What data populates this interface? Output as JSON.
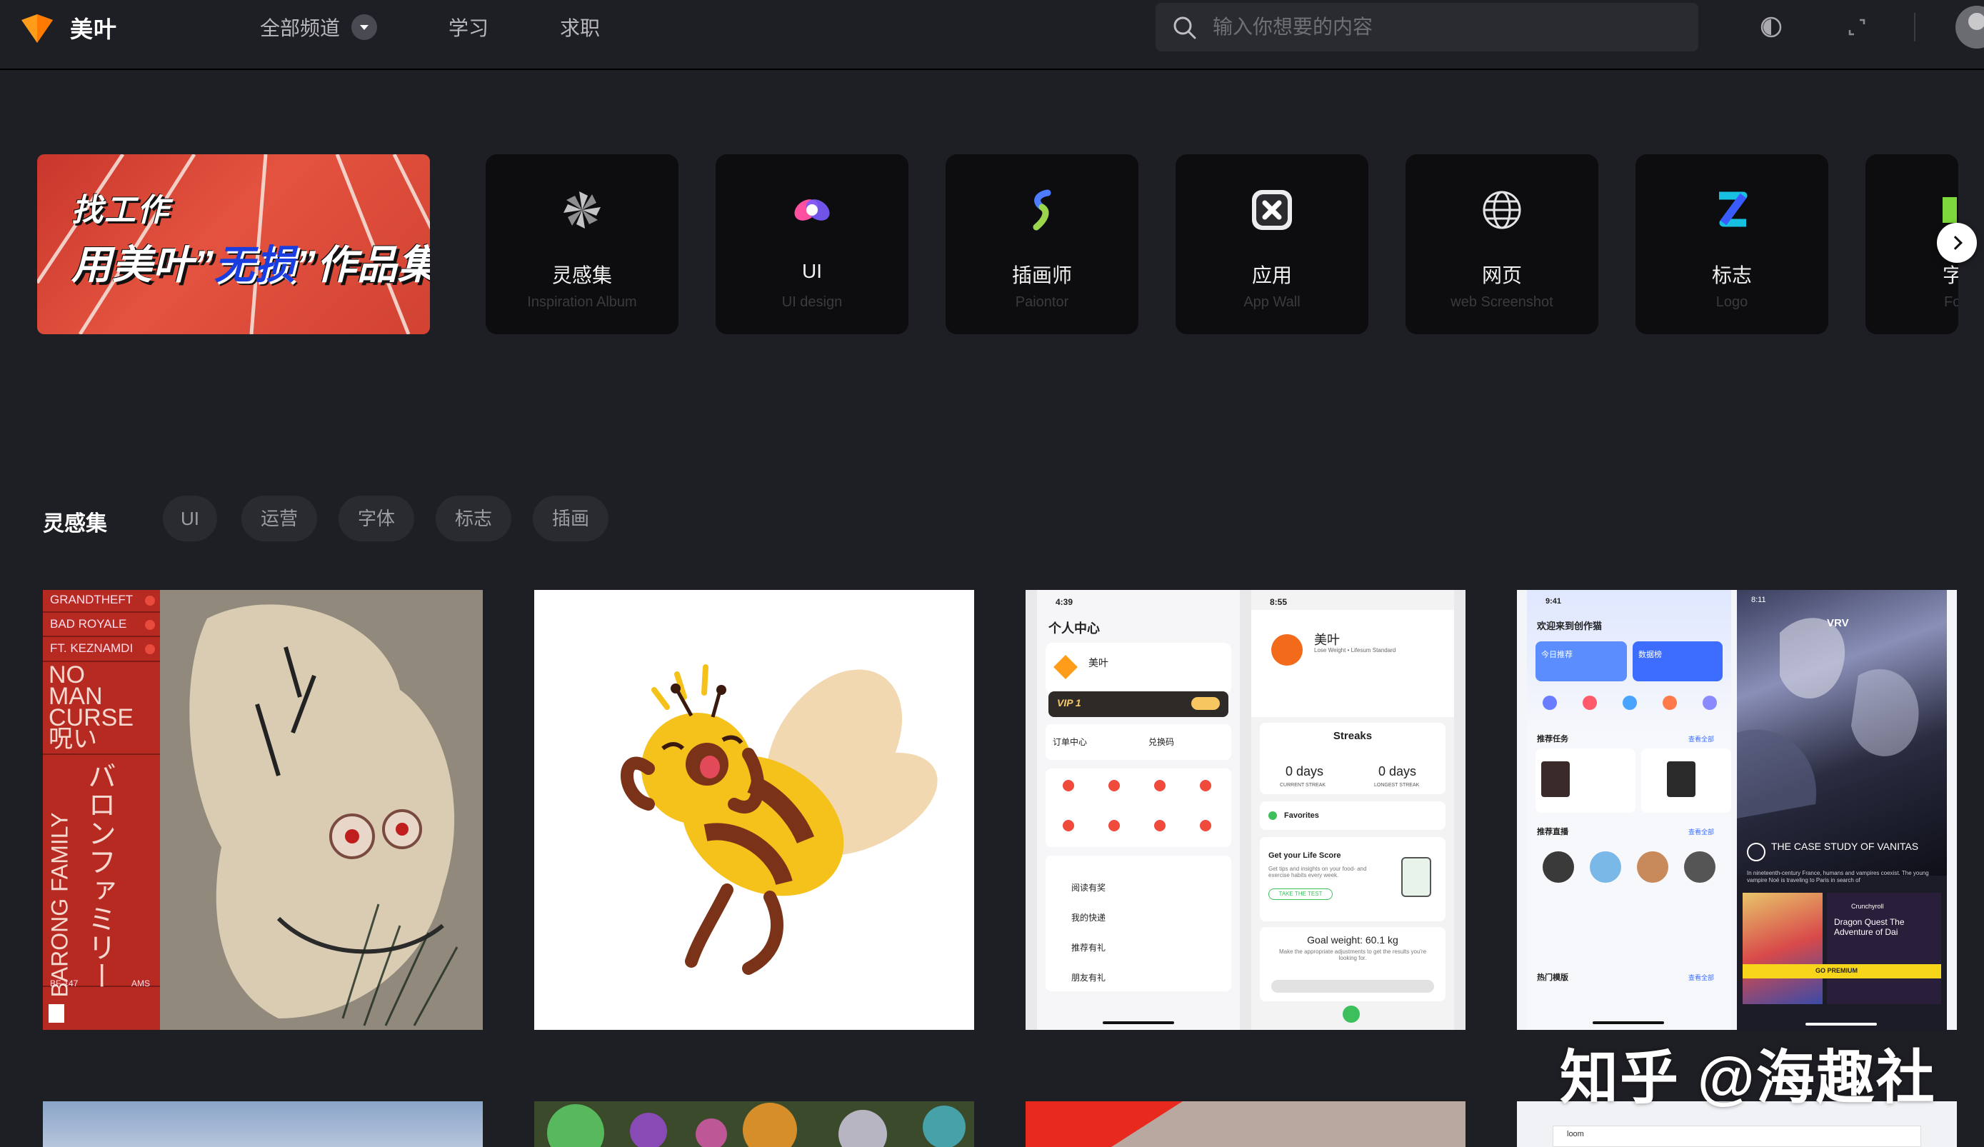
{
  "header": {
    "logo_text": "美叶",
    "nav": [
      "全部频道",
      "学习",
      "求职"
    ],
    "search_placeholder": "输入你想要的内容"
  },
  "banner": {
    "line1": "找工作",
    "line2_a": "用美叶”",
    "line2_b": "无损",
    "line2_c": "”作品集"
  },
  "categories": [
    {
      "title": "灵感集",
      "subtitle": "Inspiration Album",
      "icon": "pinwheel-icon"
    },
    {
      "title": "UI",
      "subtitle": "UI design",
      "icon": "ui-logo-icon"
    },
    {
      "title": "插画师",
      "subtitle": "Paiontor",
      "icon": "brush-icon"
    },
    {
      "title": "应用",
      "subtitle": "App Wall",
      "icon": "app-icon"
    },
    {
      "title": "网页",
      "subtitle": "web Screenshot",
      "icon": "globe-icon"
    },
    {
      "title": "标志",
      "subtitle": "Logo",
      "icon": "logo-z-icon"
    },
    {
      "title": "字",
      "subtitle": "Fo",
      "icon": "font-icon"
    }
  ],
  "section": {
    "title": "灵感集",
    "tags": [
      "UI",
      "运营",
      "字体",
      "标志",
      "插画"
    ]
  },
  "poster": {
    "labels": [
      "GRANDTHEFT",
      "BAD ROYALE",
      "FT. KEZNAMDI"
    ],
    "big": "NO MAN CURSE 呪い",
    "side": "BARONG FAMILY",
    "jp": "バロンファミリー",
    "catalog": "BF-147",
    "ams": "AMS"
  },
  "phone1": {
    "time": "4:39",
    "title": "个人中心",
    "user": "美叶",
    "vip": "VIP 1",
    "row1": [
      "订单中心",
      "兑换码"
    ],
    "list": [
      "阅读有奖",
      "我的快递",
      "推荐有礼",
      "朋友有礼"
    ]
  },
  "phone2": {
    "time": "8:55",
    "app": "美叶",
    "sub": "Lose Weight • Lifesum Standard",
    "streaks": "Streaks",
    "d1": "0 days",
    "d1l": "CURRENT STREAK",
    "d2": "0 days",
    "d2l": "LONGEST STREAK",
    "fav": "Favorites",
    "score": "Get your Life Score",
    "score_desc": "Get tips and insights on your food- and exercise habits every week.",
    "take": "TAKE THE TEST",
    "goal": "Goal weight: 60.1 kg",
    "goal_desc": "Make the appropriate adjustments to get the results you're looking for."
  },
  "phone3": {
    "time": "9:41",
    "title": "欢迎来到创作猫",
    "b1": "今日推荐",
    "b2": "数据榜",
    "sec1": "推荐任务",
    "sec2": "推荐直播",
    "sec3": "热门模版",
    "more": "查看全部"
  },
  "phone4": {
    "time": "8:11",
    "brand": "VRV",
    "title": "THE CASE STUDY OF VANITAS",
    "desc": "In nineteenth-century France, humans and vampires coexist. The young vampire Noé is traveling to Paris in search of",
    "crunchy": "Crunchyroll",
    "dq": "Dragon Quest The Adventure of Dai",
    "prem": "GO PREMIUM"
  },
  "bottom_tile": "loom",
  "watermark": "知乎 @海趣社"
}
